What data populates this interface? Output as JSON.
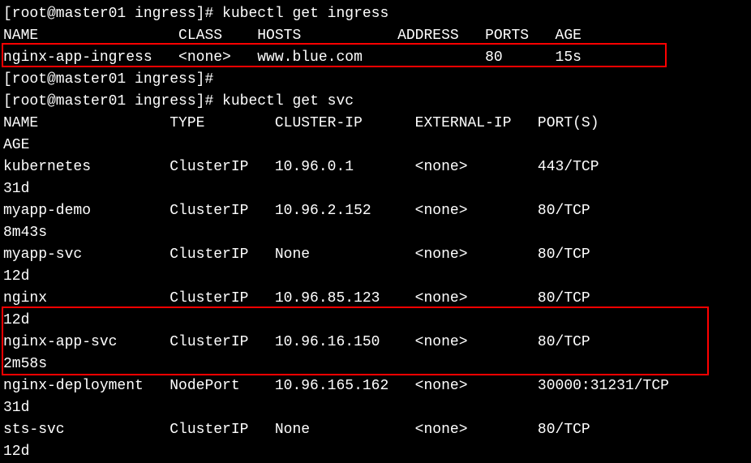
{
  "prompt1": "[root@master01 ingress]# ",
  "cmd1": "kubectl get ingress",
  "ingress_header": "NAME                CLASS    HOSTS           ADDRESS   PORTS   AGE",
  "ingress_row": "nginx-app-ingress   <none>   www.blue.com              80      15s",
  "prompt2": "[root@master01 ingress]#",
  "prompt3": "[root@master01 ingress]# ",
  "cmd2": "kubectl get svc",
  "svc_header": "NAME               TYPE        CLUSTER-IP      EXTERNAL-IP   PORT(S)         AGE",
  "svc_rows": [
    "kubernetes         ClusterIP   10.96.0.1       <none>        443/TCP         31d",
    "myapp-demo         ClusterIP   10.96.2.152     <none>        80/TCP       8m43s",
    "myapp-svc          ClusterIP   None            <none>        80/TCP         12d",
    "nginx              ClusterIP   10.96.85.123    <none>        80/TCP         12d",
    "nginx-app-svc      ClusterIP   10.96.16.150    <none>        80/TCP       2m58s",
    "nginx-deployment   NodePort    10.96.165.162   <none>        30000:31231/TCP 31d",
    "sts-svc            ClusterIP   None            <none>        80/TCP         12d"
  ]
}
